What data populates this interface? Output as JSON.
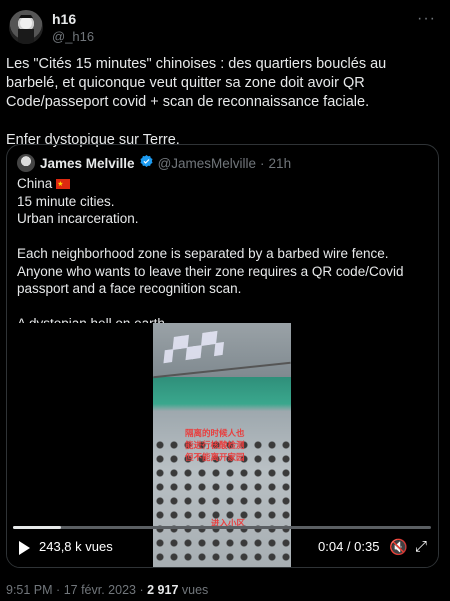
{
  "author": {
    "name": "h16",
    "handle": "@_h16"
  },
  "more_label": "···",
  "tweet_text": [
    "Les \"Cités 15 minutes\" chinoises : des quartiers bouclés au barbelé, et quiconque veut quitter sa zone doit avoir QR Code/passeport covid + scan de reconnaissance faciale.",
    "Enfer dystopique sur Terre."
  ],
  "quoted": {
    "name": "James Melville",
    "handle": "@JamesMelville",
    "dot": "·",
    "time": "21h",
    "line1": "China",
    "line2": "15 minute cities.",
    "line3": "Urban incarceration.",
    "para2": "Each neighborhood zone is separated by a barbed wire fence. Anyone who wants to leave their zone requires a QR code/Covid passport and a face recognition scan.",
    "para3": "A dystopian hell on earth."
  },
  "video": {
    "views": "243,8 k vues",
    "time": "0:04 / 0:35",
    "progress": 0.114,
    "captions": [
      "隔离的时候人也",
      "能进行核酸检测",
      "但不能离开家园",
      "进入小区"
    ]
  },
  "meta": {
    "time": "9:51 PM",
    "sep": "·",
    "date": "17 févr. 2023",
    "views_count": "2 917",
    "views_label": "vues"
  },
  "colors": {
    "background": "#000000",
    "text": "#e7e9ea",
    "muted": "#71767b",
    "verified": "#1d9bf0",
    "border": "#2f3336"
  }
}
